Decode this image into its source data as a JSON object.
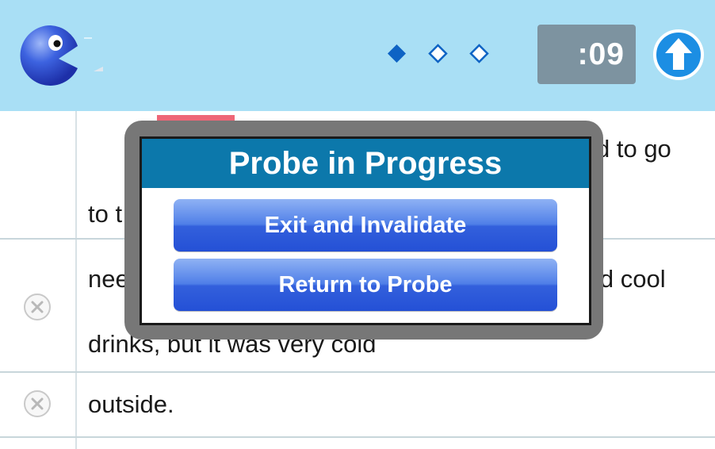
{
  "header": {
    "mascot_icon": "chomper-mascot-icon",
    "progress_diamonds": [
      {
        "state": "filled",
        "icon": "diamond-filled-icon"
      },
      {
        "state": "empty",
        "icon": "diamond-empty-icon"
      },
      {
        "state": "empty",
        "icon": "diamond-empty-icon"
      }
    ],
    "timer_text": ":09",
    "upload_icon": "arrow-up-circle-icon"
  },
  "rows": [
    {
      "line1": "d to go",
      "line2": "to t",
      "has_delete": false
    },
    {
      "line1_left": "nee",
      "line1_right": "ld cool",
      "line2": "drinks, but it was very cold",
      "has_delete": true
    },
    {
      "line1": "outside.",
      "has_delete": true
    }
  ],
  "modal": {
    "title": "Probe in Progress",
    "exit_button": "Exit and Invalidate",
    "return_button": "Return to Probe"
  },
  "colors": {
    "header_bg": "#a9dff5",
    "timer_bg": "#7d93a0",
    "modal_title_bg": "#0c78ab",
    "button_blue": "#3360dc",
    "diamond_blue": "#0e63c4",
    "accent_red": "#ee6677"
  }
}
